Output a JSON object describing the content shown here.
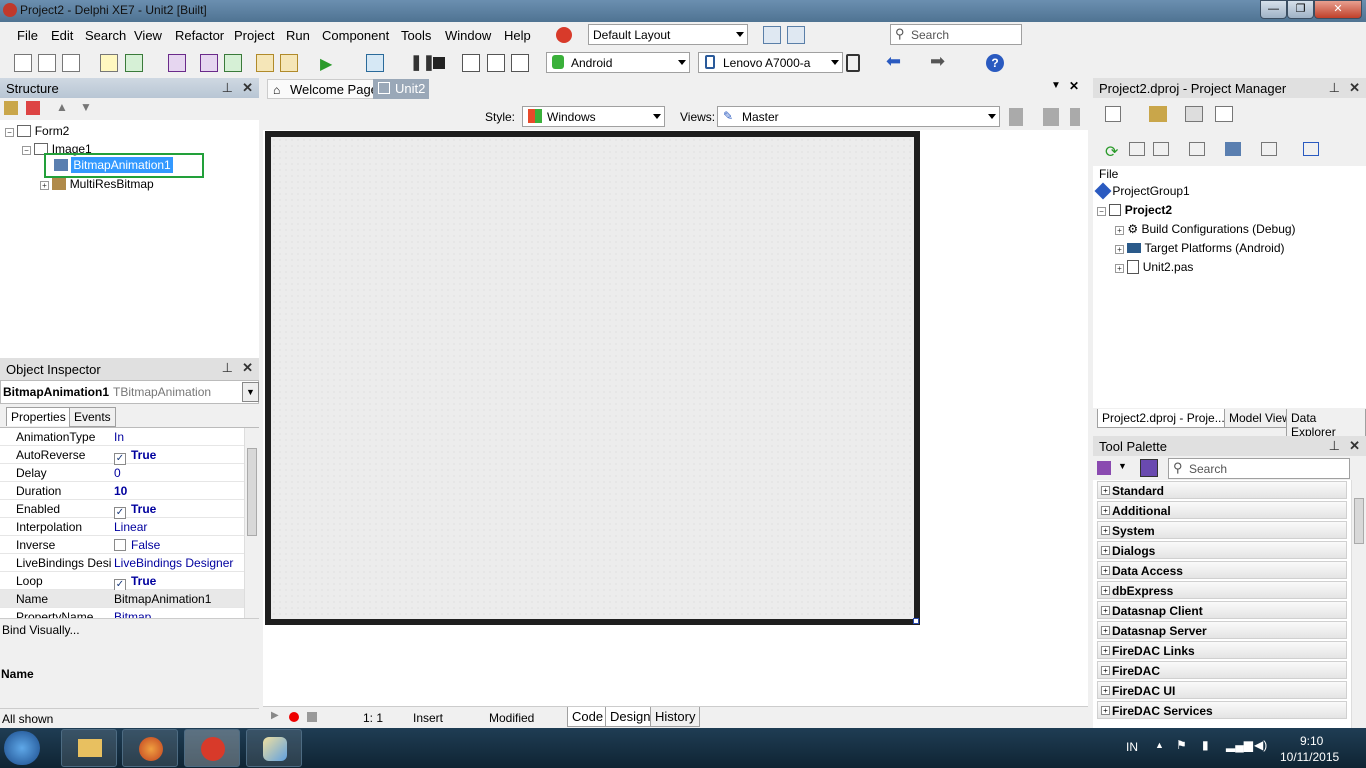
{
  "window": {
    "title": "Project2 - Delphi XE7 - Unit2 [Built]"
  },
  "menu": [
    "File",
    "Edit",
    "Search",
    "View",
    "Refactor",
    "Project",
    "Run",
    "Component",
    "Tools",
    "Window",
    "Help"
  ],
  "toolbar": {
    "layout": "Default Layout",
    "search_placeholder": "Search",
    "platform": "Android",
    "device": "Lenovo A7000-a"
  },
  "structure": {
    "title": "Structure",
    "items": [
      "Form2",
      "Image1",
      "BitmapAnimation1",
      "MultiResBitmap"
    ]
  },
  "inspector": {
    "title": "Object Inspector",
    "object": "BitmapAnimation1",
    "type": "TBitmapAnimation",
    "tabs": [
      "Properties",
      "Events"
    ],
    "props": [
      {
        "k": "AnimationType",
        "v": "In"
      },
      {
        "k": "AutoReverse",
        "v": "True",
        "check": true,
        "bold": true
      },
      {
        "k": "Delay",
        "v": "0"
      },
      {
        "k": "Duration",
        "v": "10",
        "bold": true
      },
      {
        "k": "Enabled",
        "v": "True",
        "check": true,
        "bold": true
      },
      {
        "k": "Interpolation",
        "v": "Linear"
      },
      {
        "k": "Inverse",
        "v": "False",
        "check": false
      },
      {
        "k": "LiveBindings Designer",
        "v": "LiveBindings Designer"
      },
      {
        "k": "Loop",
        "v": "True",
        "check": true,
        "bold": true
      },
      {
        "k": "Name",
        "v": "BitmapAnimation1"
      },
      {
        "k": "PropertyName",
        "v": "Bitmap"
      }
    ],
    "bind_visually": "Bind Visually...",
    "desc_title": "Name",
    "status": "All shown"
  },
  "editor": {
    "tabs": [
      "Welcome Page",
      "Unit2"
    ],
    "style_label": "Style:",
    "style_value": "Windows",
    "views_label": "Views:",
    "views_value": "Master",
    "status": {
      "pos": "1:  1",
      "mode": "Insert",
      "modified": "Modified"
    },
    "bottom_tabs": [
      "Code",
      "Design",
      "History"
    ]
  },
  "project": {
    "title": "Project2.dproj - Project Manager",
    "file_label": "File",
    "items": [
      "ProjectGroup1",
      "Project2",
      "Build Configurations (Debug)",
      "Target Platforms (Android)",
      "Unit2.pas"
    ],
    "tabs": [
      "Project2.dproj - Proje...",
      "Model View",
      "Data Explorer"
    ]
  },
  "palette": {
    "title": "Tool Palette",
    "search_placeholder": "Search",
    "categories": [
      "Standard",
      "Additional",
      "System",
      "Dialogs",
      "Data Access",
      "dbExpress",
      "Datasnap Client",
      "Datasnap Server",
      "FireDAC Links",
      "FireDAC",
      "FireDAC UI",
      "FireDAC Services"
    ]
  },
  "taskbar": {
    "lang": "IN",
    "time": "9:10",
    "date": "10/11/2015"
  },
  "colors": {
    "selection": "#3399ff",
    "highlight_box": "#22a03a",
    "accent": "#0b3a7a"
  }
}
